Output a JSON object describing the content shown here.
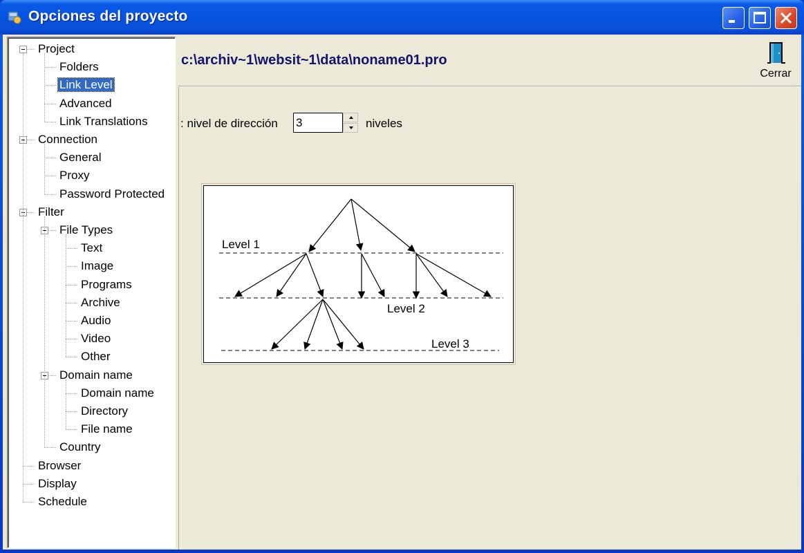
{
  "window": {
    "title": "Opciones del proyecto",
    "controls": {
      "minimize": "minimize",
      "maximize": "maximize",
      "close": "close"
    }
  },
  "tree": {
    "items": [
      {
        "label": "Project",
        "level": 0,
        "expanded": true
      },
      {
        "label": "Folders",
        "level": 1
      },
      {
        "label": "Link Level",
        "level": 1,
        "selected": true
      },
      {
        "label": "Advanced",
        "level": 1
      },
      {
        "label": "Link Translations",
        "level": 1
      },
      {
        "label": "Connection",
        "level": 0,
        "expanded": true
      },
      {
        "label": "General",
        "level": 1
      },
      {
        "label": "Proxy",
        "level": 1
      },
      {
        "label": "Password Protected",
        "level": 1
      },
      {
        "label": "Filter",
        "level": 0,
        "expanded": true
      },
      {
        "label": "File Types",
        "level": 1,
        "expanded": true
      },
      {
        "label": "Text",
        "level": 2
      },
      {
        "label": "Image",
        "level": 2
      },
      {
        "label": "Programs",
        "level": 2
      },
      {
        "label": "Archive",
        "level": 2
      },
      {
        "label": "Audio",
        "level": 2
      },
      {
        "label": "Video",
        "level": 2
      },
      {
        "label": "Other",
        "level": 2
      },
      {
        "label": "Domain name",
        "level": 1,
        "expanded": true
      },
      {
        "label": "Domain name",
        "level": 2
      },
      {
        "label": "Directory",
        "level": 2
      },
      {
        "label": "File name",
        "level": 2
      },
      {
        "label": "Country",
        "level": 1
      },
      {
        "label": "Browser",
        "level": 0
      },
      {
        "label": "Display",
        "level": 0
      },
      {
        "label": "Schedule",
        "level": 0
      }
    ]
  },
  "header": {
    "project_path": "c:\\archiv~1\\websit~1\\data\\noname01.pro",
    "close_label": "Cerrar",
    "close_icon": "door-icon"
  },
  "link_level": {
    "label": ": nivel de dirección",
    "value": "3",
    "unit": "niveles"
  },
  "diagram": {
    "levels": [
      "Level 1",
      "Level 2",
      "Level 3"
    ]
  },
  "colors": {
    "title_bar": "#0553e0",
    "selection": "#316ac5",
    "path_text": "#13136e",
    "dialog_bg": "#ece9d8"
  }
}
